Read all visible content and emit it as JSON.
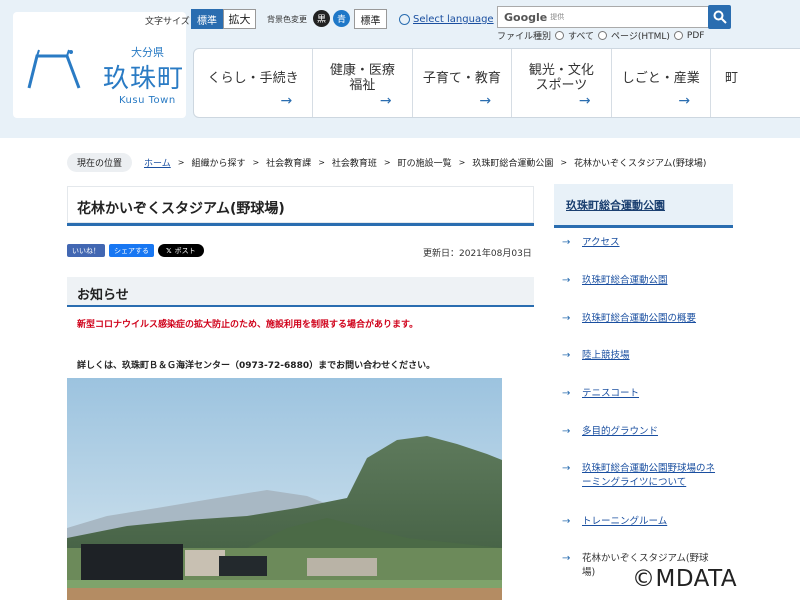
{
  "header": {
    "logo": {
      "prefecture": "大分県",
      "town": "玖珠町",
      "town_en": "Kusu Town"
    },
    "font_size_label": "文字サイズ",
    "font_size_standard": "標準",
    "font_size_large": "拡大",
    "bg_color_label": "背景色変更",
    "bg_black": "黒",
    "bg_blue": "青",
    "bg_standard": "標準",
    "select_language": "Select language",
    "search": {
      "google": "Google",
      "provided": "提供"
    },
    "filetype": {
      "label": "ファイル種別",
      "all": "すべて",
      "html": "ページ(HTML)",
      "pdf": "PDF"
    }
  },
  "nav": [
    {
      "line1": "くらし・手続き",
      "line2": ""
    },
    {
      "line1": "健康・医療",
      "line2": "福祉"
    },
    {
      "line1": "子育て・教育",
      "line2": ""
    },
    {
      "line1": "観光・文化",
      "line2": "スポーツ"
    },
    {
      "line1": "しごと・産業",
      "line2": ""
    },
    {
      "line1": "町",
      "line2": ""
    }
  ],
  "breadcrumb": {
    "here": "現在の位置",
    "items": [
      "ホーム",
      "組織から探す",
      "社会教育課",
      "社会教育班",
      "町の施設一覧",
      "玖珠町総合運動公園",
      "花林かいぞくスタジアム(野球場)"
    ]
  },
  "page": {
    "title": "花林かいぞくスタジアム(野球場)",
    "like": "いいね！",
    "share": "シェアする",
    "post": "ポスト",
    "updated": "更新日：2021年08月03日",
    "notice_heading": "お知らせ",
    "notice_red": "新型コロナウイルス感染症の拡大防止のため、施設利用を制限する場合があります。",
    "contact": "詳しくは、玖珠町Ｂ＆Ｇ海洋センター（0973-72-6880）までお問い合わせください。"
  },
  "sidebar": {
    "title": "玖珠町総合運動公園",
    "items": [
      {
        "line1": "アクセス",
        "line2": ""
      },
      {
        "line1": "玖珠町総合運動公園",
        "line2": ""
      },
      {
        "line1": "玖珠町総合運動公園の概要",
        "line2": ""
      },
      {
        "line1": "陸上競技場",
        "line2": ""
      },
      {
        "line1": "テニスコート",
        "line2": ""
      },
      {
        "line1": "多目的グラウンド",
        "line2": ""
      },
      {
        "line1": "玖珠町総合運動公園野球場のネ",
        "line2": "ーミングライツについて"
      },
      {
        "line1": "トレーニングルーム",
        "line2": ""
      },
      {
        "line1": "花林かいぞくスタジアム(野球",
        "line2": "場)"
      }
    ]
  },
  "copyright": "©MDATA",
  "colors": {
    "accent": "#2a6db0",
    "header_bg": "#e8f1f8",
    "notice_red": "#d0021b"
  }
}
